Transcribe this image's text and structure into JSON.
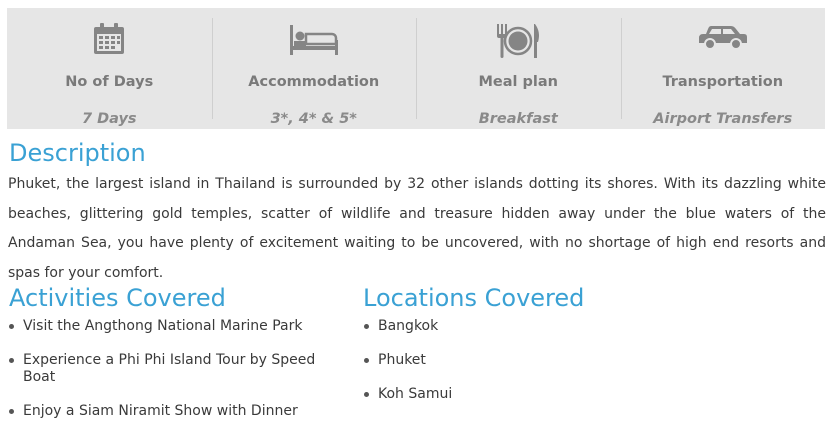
{
  "summary": [
    {
      "label": "No of Days",
      "value": "7 Days",
      "icon": "calendar-icon"
    },
    {
      "label": "Accommodation",
      "value": "3*, 4* & 5*",
      "icon": "bed-icon"
    },
    {
      "label": "Meal plan",
      "value": "Breakfast",
      "icon": "plate-cutlery-icon"
    },
    {
      "label": "Transportation",
      "value": "Airport Transfers",
      "icon": "car-icon"
    }
  ],
  "description": {
    "heading": "Description",
    "text": "Phuket, the largest island in Thailand is surrounded by 32 other islands dotting its shores.  With its dazzling white beaches, glittering gold temples, scatter of wildlife and treasure hidden away under the blue waters of the Andaman Sea, you have plenty of excitement waiting to be uncovered, with no shortage of high end resorts and spas for your comfort."
  },
  "activities": {
    "heading": "Activities Covered",
    "items": [
      "Visit the Angthong National Marine Park",
      "Experience a Phi Phi Island Tour by Speed Boat",
      "Enjoy a Siam Niramit Show with Dinner"
    ]
  },
  "locations": {
    "heading": "Locations Covered",
    "items": [
      "Bangkok",
      "Phuket",
      "Koh Samui"
    ]
  },
  "colors": {
    "accent": "#3aa1d4",
    "panel": "#e6e6e6",
    "icon": "#858585"
  }
}
